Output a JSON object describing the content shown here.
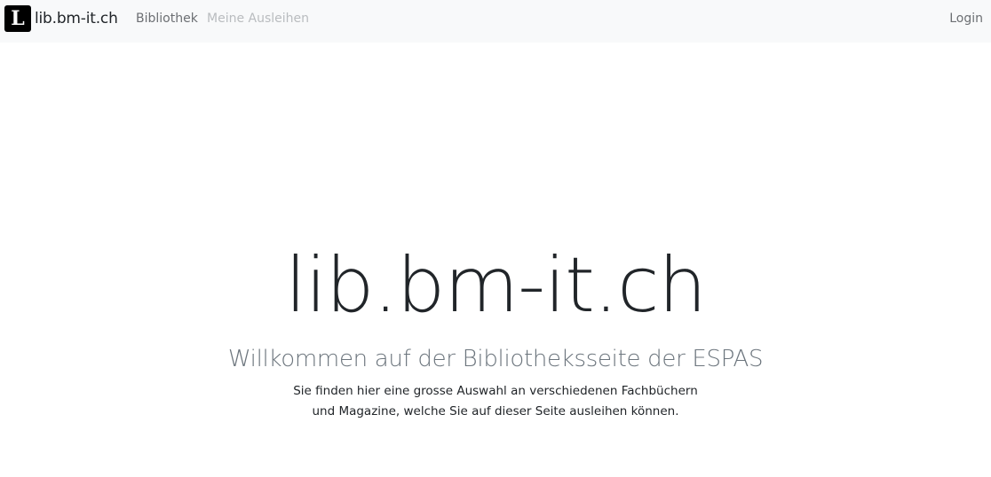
{
  "navbar": {
    "brand_text": "lib.bm-it.ch",
    "brand_logo_letter": "L",
    "brand_icon": "library-logo-icon",
    "links": [
      {
        "label": "Bibliothek"
      },
      {
        "label": "Meine Ausleihen"
      }
    ],
    "login_label": "Login"
  },
  "hero": {
    "title": "lib.bm-it.ch",
    "subtitle": "Willkommen auf der Bibliotheksseite der ESPAS",
    "text_line1": "Sie finden hier eine grosse Auswahl an verschiedenen Fachbüchern",
    "text_line2": "und Magazine, welche Sie auf dieser Seite ausleihen können."
  },
  "colors": {
    "navbar_bg": "#f8f9fa",
    "text_dark": "#212529",
    "text_muted": "#6c757d",
    "link_disabled": "#b9bcbf"
  }
}
